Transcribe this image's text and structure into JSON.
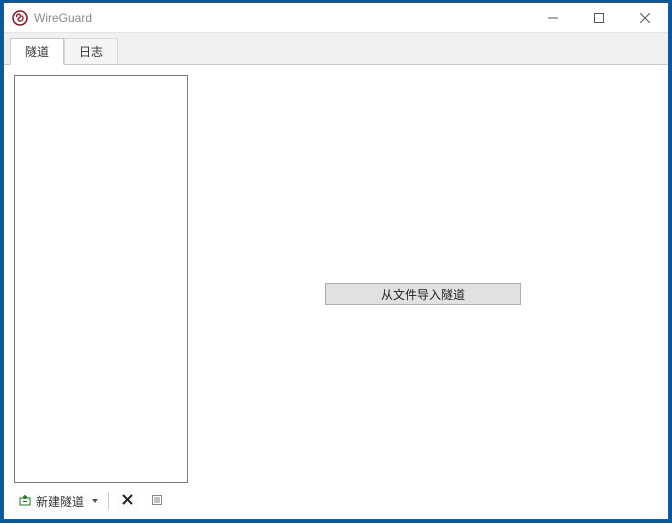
{
  "window": {
    "title": "WireGuard"
  },
  "tabs": {
    "tunnel": "隧道",
    "log": "日志"
  },
  "toolbar": {
    "new_tunnel_label": "新建隧道"
  },
  "main": {
    "import_button_label": "从文件导入隧道"
  }
}
